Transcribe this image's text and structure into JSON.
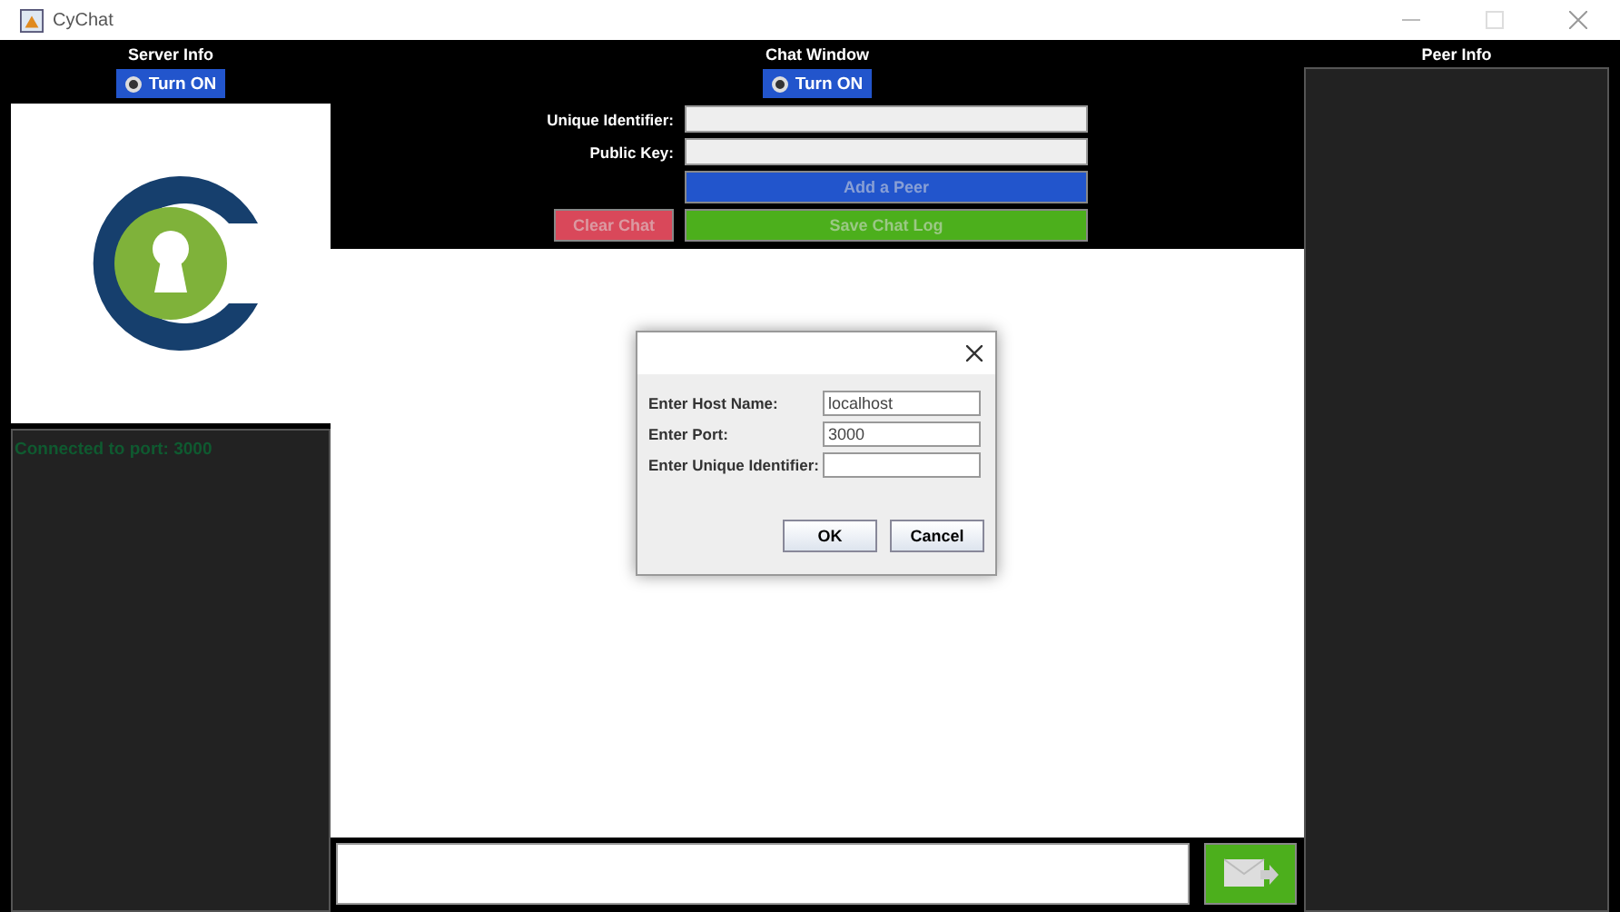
{
  "window": {
    "title": "CyChat"
  },
  "server_info": {
    "title": "Server Info",
    "toggle": "Turn ON",
    "toggle_selected": false,
    "log": "Connected to port: 3000"
  },
  "chat_window": {
    "title": "Chat Window",
    "toggle": "Turn ON",
    "toggle_selected": false,
    "fields": [
      {
        "label": "Unique Identifier:"
      },
      {
        "label": "Public Key:"
      }
    ],
    "buttons": [
      {
        "label": "Add a Peer",
        "kind": "add",
        "disabled": true
      },
      {
        "label": "Clear Chat",
        "kind": "clear",
        "disabled": true
      },
      {
        "label": "Save Chat Log",
        "kind": "save",
        "disabled": true
      }
    ]
  },
  "peer_info": {
    "title": "Peer Info"
  },
  "dialog": {
    "fields": [
      {
        "label": "Enter Host Name:",
        "value": "localhost"
      },
      {
        "label": "Enter Port:",
        "value": "3000"
      },
      {
        "label": "Enter Unique Identifier:"
      }
    ],
    "buttons": [
      "OK",
      "Cancel"
    ]
  }
}
